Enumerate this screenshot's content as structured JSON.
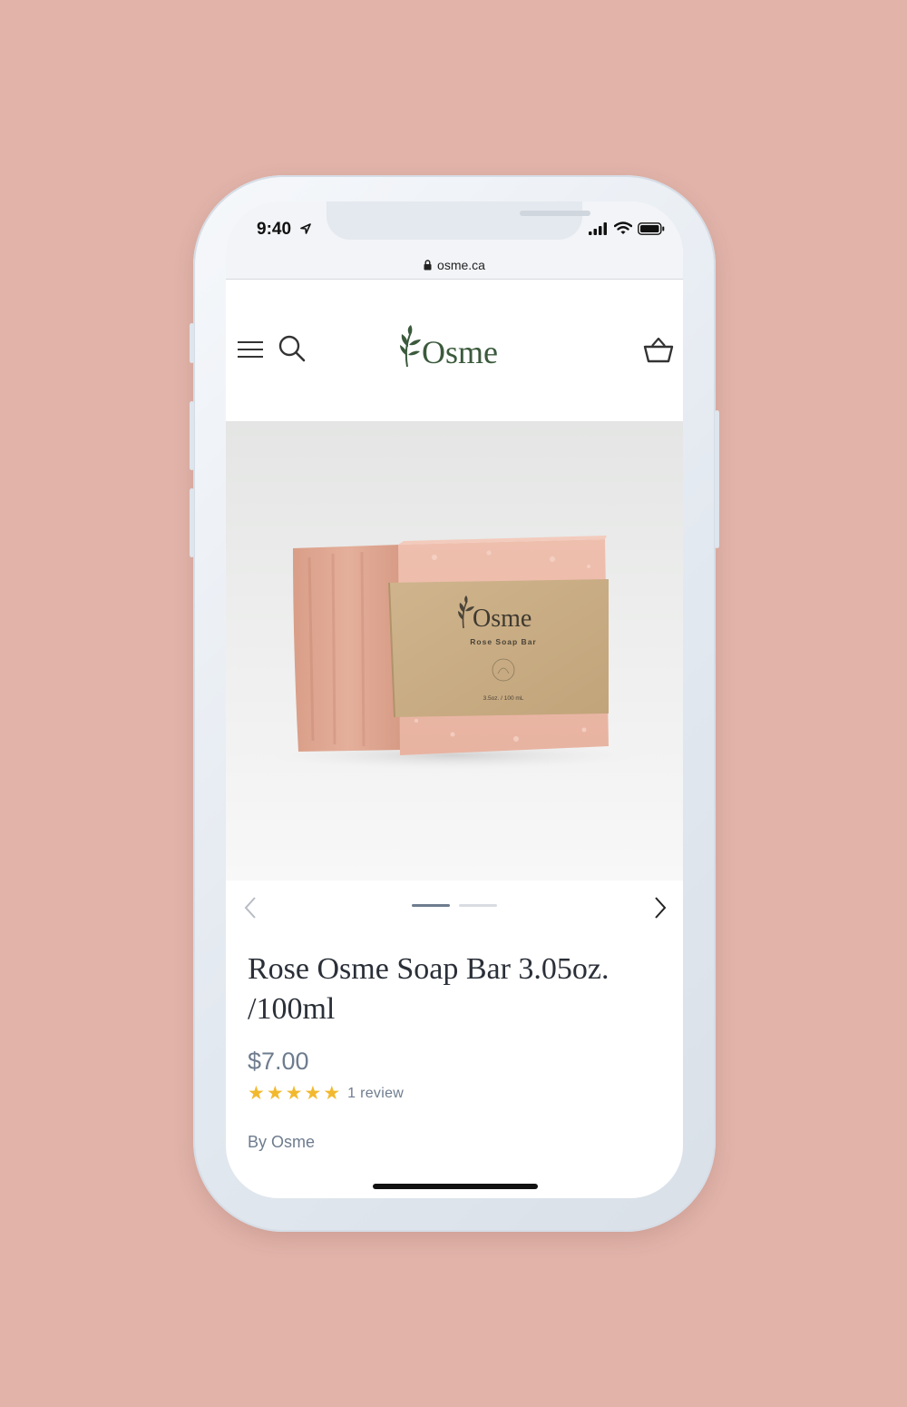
{
  "status_bar": {
    "time": "9:40"
  },
  "browser": {
    "url": "osme.ca"
  },
  "header": {
    "brand": "Osme"
  },
  "product_image": {
    "brand": "Osme",
    "label": "Rose Soap Bar",
    "size": "3.5oz. / 100 mL"
  },
  "carousel": {
    "current_slide": 1,
    "slide_count": 2
  },
  "product": {
    "title": "Rose Osme Soap Bar 3.05oz. /100ml",
    "price": "$7.00",
    "rating_stars": 5,
    "review_count": "1 review",
    "vendor": "By Osme"
  },
  "colors": {
    "background": "#e1b3a9",
    "brand_green": "#3b5a3c",
    "star": "#f2b92f",
    "muted_text": "#6e7c8e"
  }
}
